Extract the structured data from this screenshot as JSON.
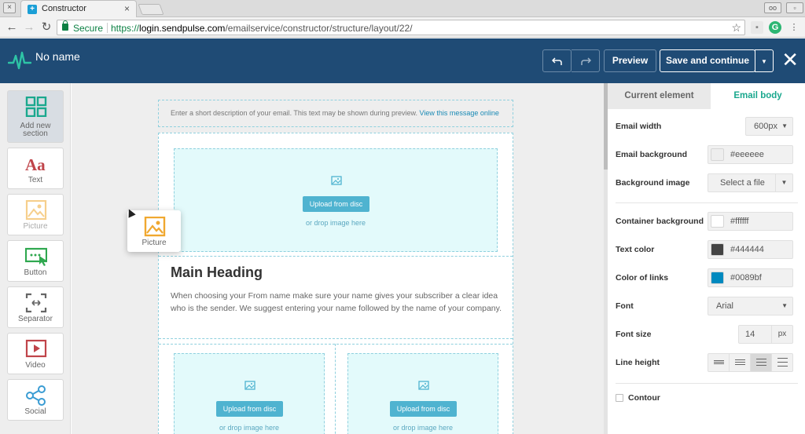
{
  "browser": {
    "tab_title": "Constructor",
    "tab_close": "×",
    "secure_label": "Secure",
    "url_scheme": "https://",
    "url_host": "login.sendpulse.com",
    "url_path": "/emailservice/constructor/structure/layout/22/"
  },
  "header": {
    "doc_name": "No name",
    "undo_icon": "undo-icon",
    "redo_icon": "redo-icon",
    "preview_label": "Preview",
    "save_label": "Save and continue",
    "close_glyph": "✕",
    "brand_color": "#1f4b75",
    "accent_color": "#1aa88e"
  },
  "tools": [
    {
      "label": "Add new section",
      "icon": "grid-icon"
    },
    {
      "label": "Text",
      "icon": "text-aa-icon"
    },
    {
      "label": "Picture",
      "icon": "picture-icon"
    },
    {
      "label": "Button",
      "icon": "button-icon"
    },
    {
      "label": "Separator",
      "icon": "separator-icon"
    },
    {
      "label": "Video",
      "icon": "video-icon"
    },
    {
      "label": "Social",
      "icon": "share-icon"
    }
  ],
  "canvas": {
    "preheader_text": "Enter a short description of your email. This text may be shown during preview.",
    "preheader_link": "View this message online",
    "upload_label": "Upload from disc",
    "drop_text": "or drop image here",
    "main_heading": "Main Heading",
    "body_text": "When choosing your From name make sure your name gives your subscriber a clear idea who is the sender. We suggest entering your name followed by the name of your company.",
    "drag_card_label": "Picture"
  },
  "panel": {
    "tab_current": "Current element",
    "tab_body": "Email body",
    "email_width_label": "Email width",
    "email_width_value": "600px",
    "email_background_label": "Email background",
    "email_background_value": "#eeeeee",
    "background_image_label": "Background image",
    "background_image_value": "Select a file",
    "container_background_label": "Container background",
    "container_background_value": "#ffffff",
    "text_color_label": "Text color",
    "text_color_value": "#444444",
    "link_color_label": "Color of links",
    "link_color_value": "#0089bf",
    "font_label": "Font",
    "font_value": "Arial",
    "font_size_label": "Font size",
    "font_size_value": "14",
    "font_size_unit": "px",
    "line_height_label": "Line height",
    "contour_label": "Contour"
  }
}
